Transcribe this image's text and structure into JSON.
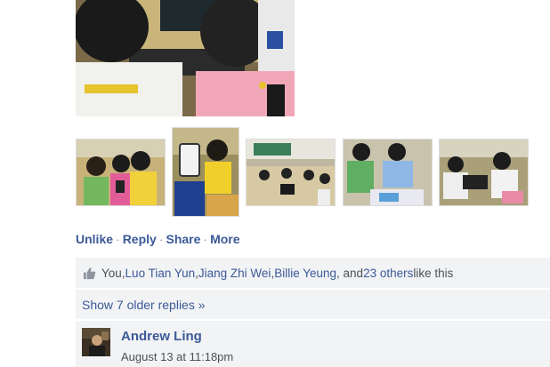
{
  "post": {
    "main_photo_alt": "main-photo",
    "thumbnails": [
      {
        "name": "photo-thumbnail-1"
      },
      {
        "name": "photo-thumbnail-2"
      },
      {
        "name": "photo-thumbnail-3"
      },
      {
        "name": "photo-thumbnail-4"
      },
      {
        "name": "photo-thumbnail-5"
      }
    ]
  },
  "actions": {
    "unlike": "Unlike",
    "reply": "Reply",
    "share": "Share",
    "more": "More",
    "separator": "·"
  },
  "likes": {
    "prefix": "You, ",
    "people": [
      "Luo Tian Yun",
      "Jiang Zhi Wei",
      "Billie Yeung"
    ],
    "comma": ", ",
    "and": ", and ",
    "others_link": "23 others",
    "suffix": " like this"
  },
  "older_replies": "Show 7 older replies »",
  "comment": {
    "author": "Andrew Ling",
    "timestamp": "August 13 at 11:18pm"
  },
  "colors": {
    "link": "#3b5998",
    "panel_bg": "#f2f3f5",
    "text": "#4b4f56"
  }
}
